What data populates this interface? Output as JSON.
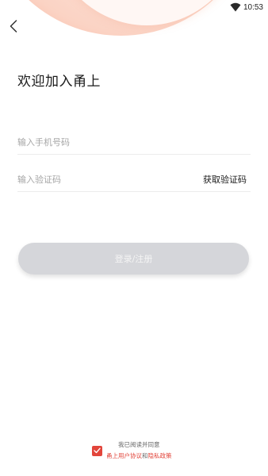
{
  "status_bar": {
    "time": "10:53",
    "wifi_icon": "wifi-icon"
  },
  "header": {
    "back_icon": "chevron-left-icon"
  },
  "title": "欢迎加入甬上",
  "form": {
    "phone_placeholder": "输入手机号码",
    "code_placeholder": "输入验证码",
    "get_code_label": "获取验证码",
    "submit_label": "登录/注册"
  },
  "agreement": {
    "checked": true,
    "line1": "我已阅读并同意",
    "user_agreement": "甬上用户协议",
    "connector": "和",
    "privacy_policy": "隐私政策"
  },
  "colors": {
    "accent": "#e2453b",
    "button_disabled": "#d5d6da",
    "arc": "#f7a78c"
  }
}
